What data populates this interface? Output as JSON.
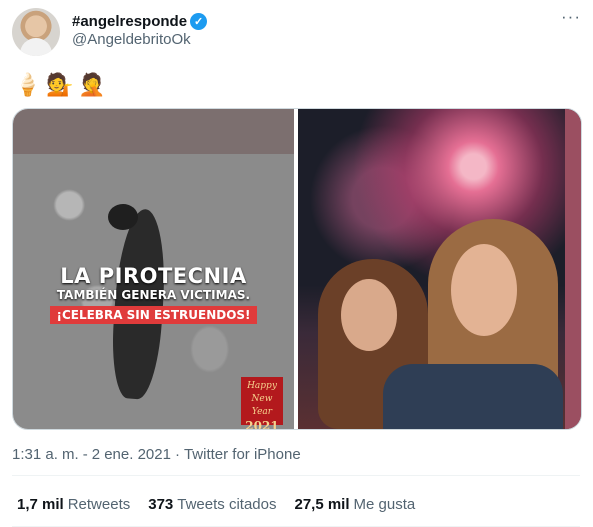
{
  "author": {
    "display_name": "#angelresponde",
    "verified_glyph": "✓",
    "handle": "@AngeldebritoOk",
    "avatar_icon": "profile-avatar"
  },
  "more_glyph": "···",
  "tweet": {
    "emojis": [
      "🍦",
      "💁",
      "🤦"
    ]
  },
  "media": {
    "left_image": {
      "headline": "LA PIROTECNIA",
      "subheadline": "TAMBIÉN GENERA VICTIMAS.",
      "callout": "¡CELEBRA SIN ESTRUENDOS!",
      "card_text": "Happy New Year",
      "card_year": "2021"
    },
    "right_image": {
      "description_icon": "fireworks-selfie-photo"
    }
  },
  "meta": {
    "time": "1:31 a. m.",
    "separator": "·",
    "date": "2 ene. 2021",
    "source": "Twitter for iPhone"
  },
  "stats": {
    "retweets_count": "1,7 mil",
    "retweets_label": "Retweets",
    "quotes_count": "373",
    "quotes_label": "Tweets citados",
    "likes_count": "27,5 mil",
    "likes_label": "Me gusta"
  },
  "colors": {
    "accent": "#1d9bf0",
    "secondary_text": "#536471",
    "primary_text": "#0f1419",
    "callout_red": "#e03b3b"
  }
}
